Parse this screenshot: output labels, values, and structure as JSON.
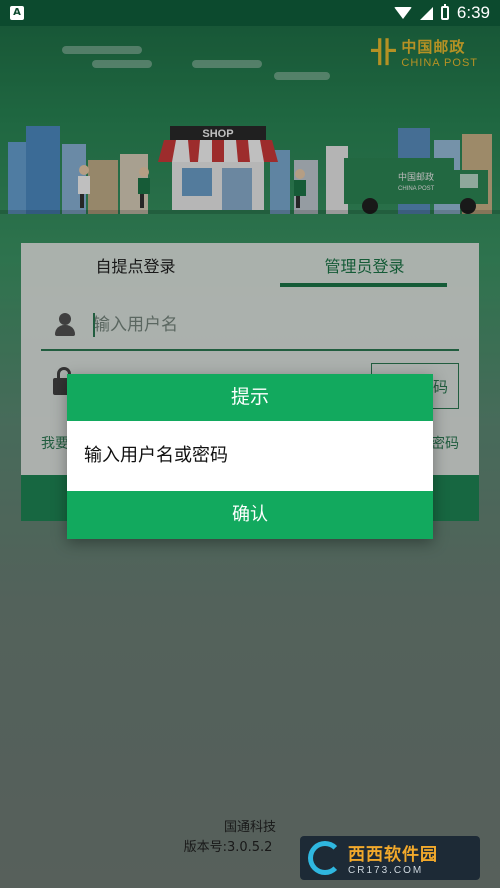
{
  "status_bar": {
    "time": "6:39",
    "notif_glyph": "A"
  },
  "logo": {
    "mark": "卝",
    "cn": "中国邮政",
    "en": "CHINA POST"
  },
  "scene": {
    "shop_sign": "SHOP",
    "truck_label": "中国邮政",
    "truck_sub": "CHINA POST"
  },
  "login": {
    "tabs": [
      {
        "label": "自提点登录"
      },
      {
        "label": "管理员登录"
      }
    ],
    "username_placeholder": "输入用户名",
    "code_button_partial": "码",
    "link_left_partial": "我要",
    "link_right_partial": "密码"
  },
  "dialog": {
    "title": "提示",
    "message": "输入用户名或密码",
    "confirm": "确认"
  },
  "footer": {
    "company": "国通科技",
    "version": "版本号:3.0.5.2"
  },
  "watermark": {
    "cn": "西西软件园",
    "en": "CR173.COM"
  },
  "colors": {
    "primary": "#12a95e",
    "dark_green": "#1d7a4a",
    "status_bar": "#0c4a2e"
  }
}
